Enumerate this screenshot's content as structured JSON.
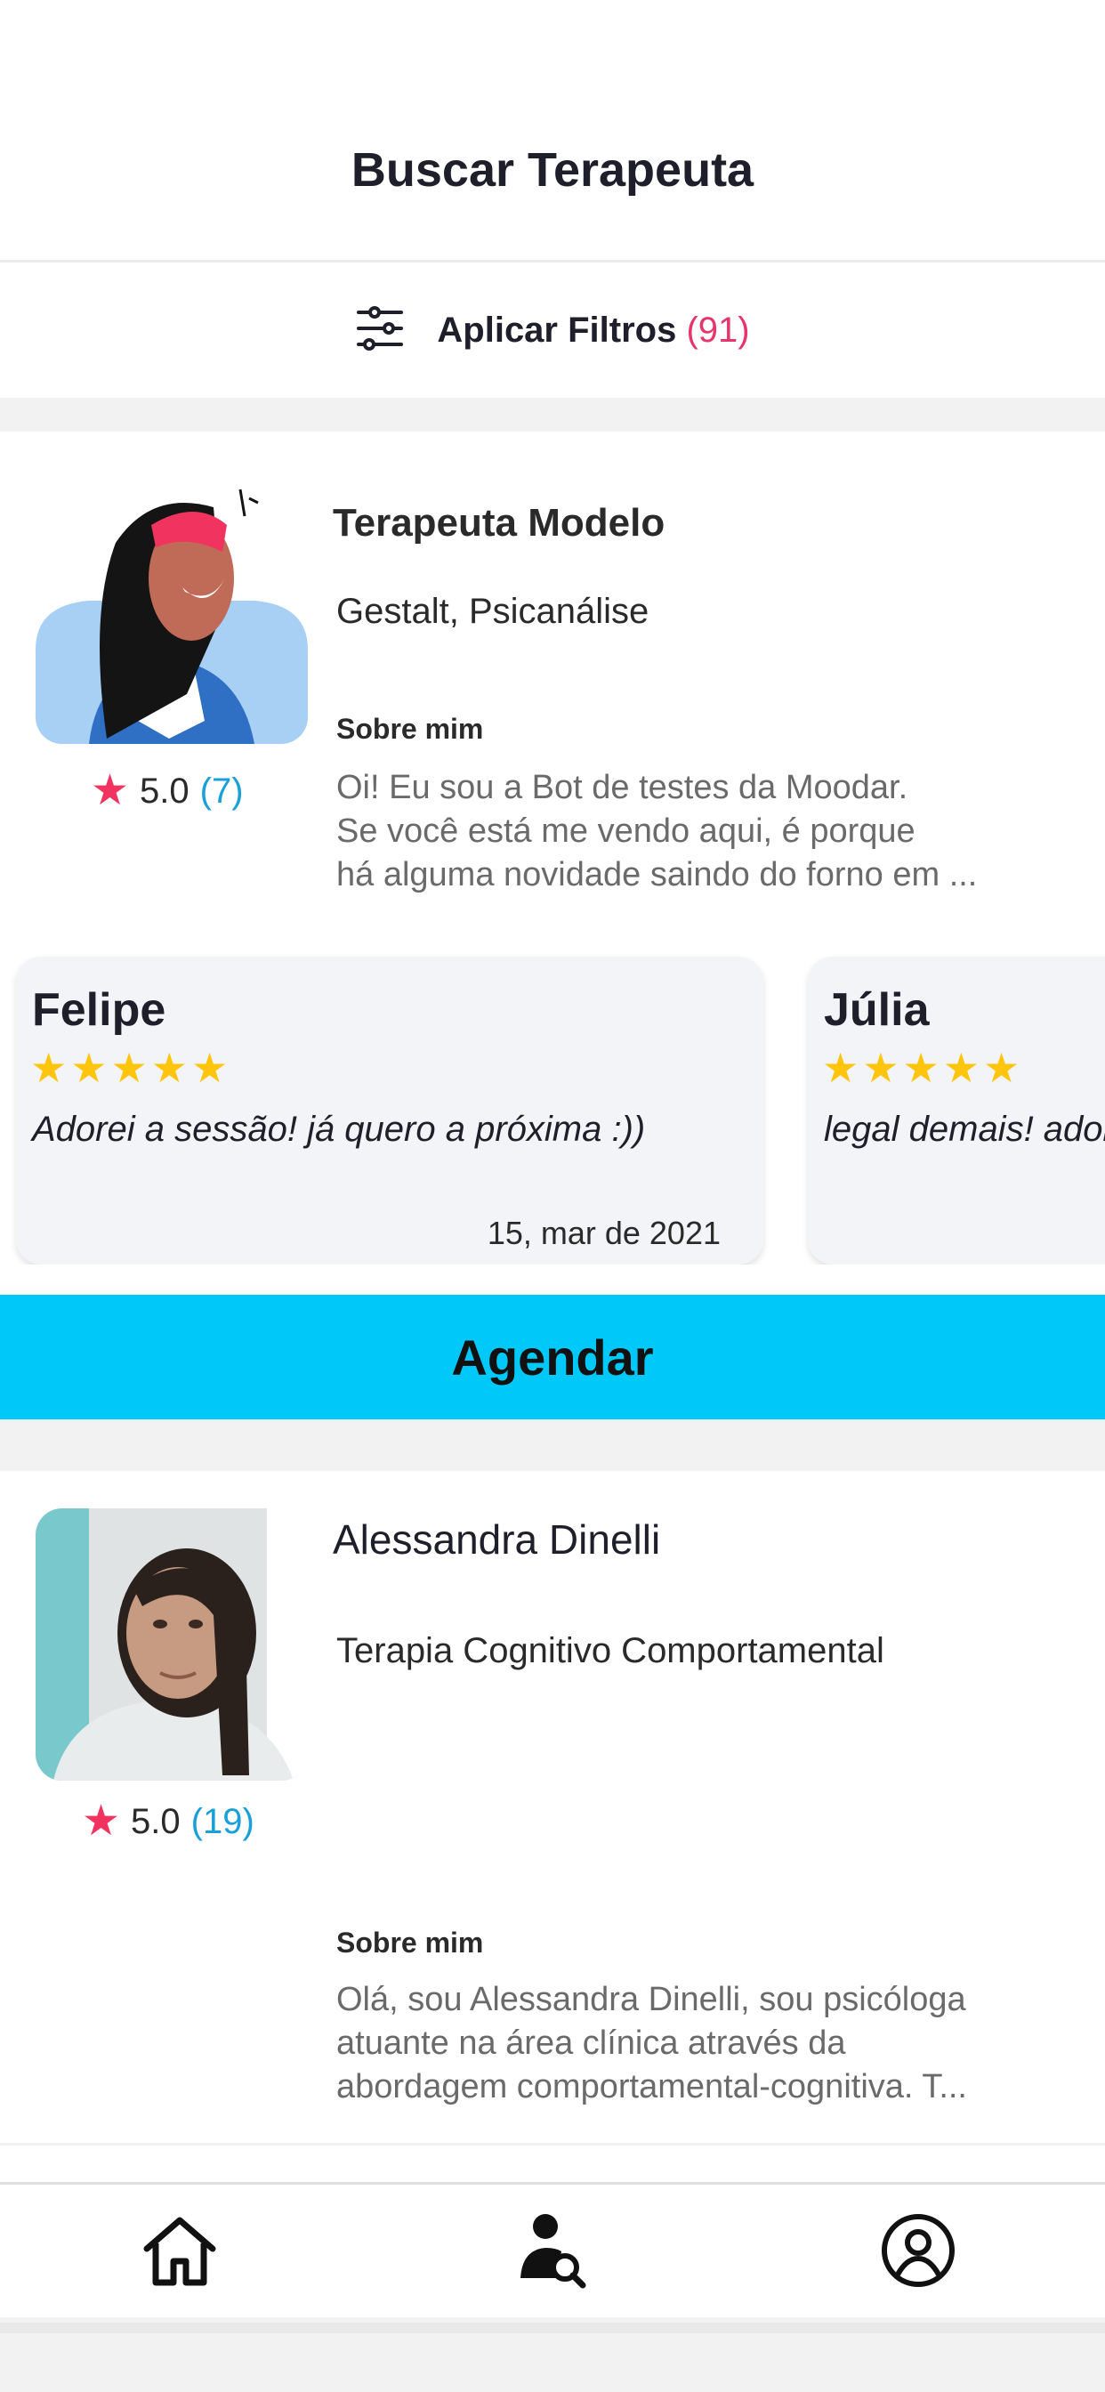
{
  "header": {
    "title": "Buscar Terapeuta"
  },
  "filters": {
    "label": "Aplicar Filtros",
    "count": "(91)",
    "icon": "filter-sliders-icon"
  },
  "therapists": [
    {
      "name": "Terapeuta Modelo",
      "rating": "5.0",
      "reviews_count": "(7)",
      "specialties": "Gestalt, Psicanálise",
      "about_label": "Sobre mim",
      "about_lines": [
        "Oi! Eu sou a Bot de testes da Moodar.",
        "Se você está me vendo aqui, é porque",
        "há alguma novidade saindo do forno em ..."
      ],
      "reviews": [
        {
          "name": "Felipe",
          "stars": "★★★★★",
          "text": "Adorei a sessão! já quero a próxima :))",
          "date": "15, mar de 2021"
        },
        {
          "name": "Júlia",
          "stars": "★★★★★",
          "text": "legal demais! adorei",
          "date": ""
        }
      ],
      "schedule_label": "Agendar"
    },
    {
      "name": "Alessandra Dinelli",
      "rating": "5.0",
      "reviews_count": "(19)",
      "specialties": "Terapia Cognitivo Comportamental",
      "about_label": "Sobre mim",
      "about_lines": [
        "Olá, sou Alessandra Dinelli, sou psicóloga",
        "atuante na área clínica através da",
        "abordagem comportamental-cognitiva. T..."
      ]
    }
  ],
  "nav": {
    "items": [
      {
        "icon": "home-icon"
      },
      {
        "icon": "search-therapist-icon"
      },
      {
        "icon": "profile-icon"
      }
    ]
  },
  "colors": {
    "accent": "#00c8f8",
    "star_rating": "#f0335f",
    "review_star": "#ffc40c",
    "count": "#e5356c",
    "link": "#1aa0d8"
  }
}
